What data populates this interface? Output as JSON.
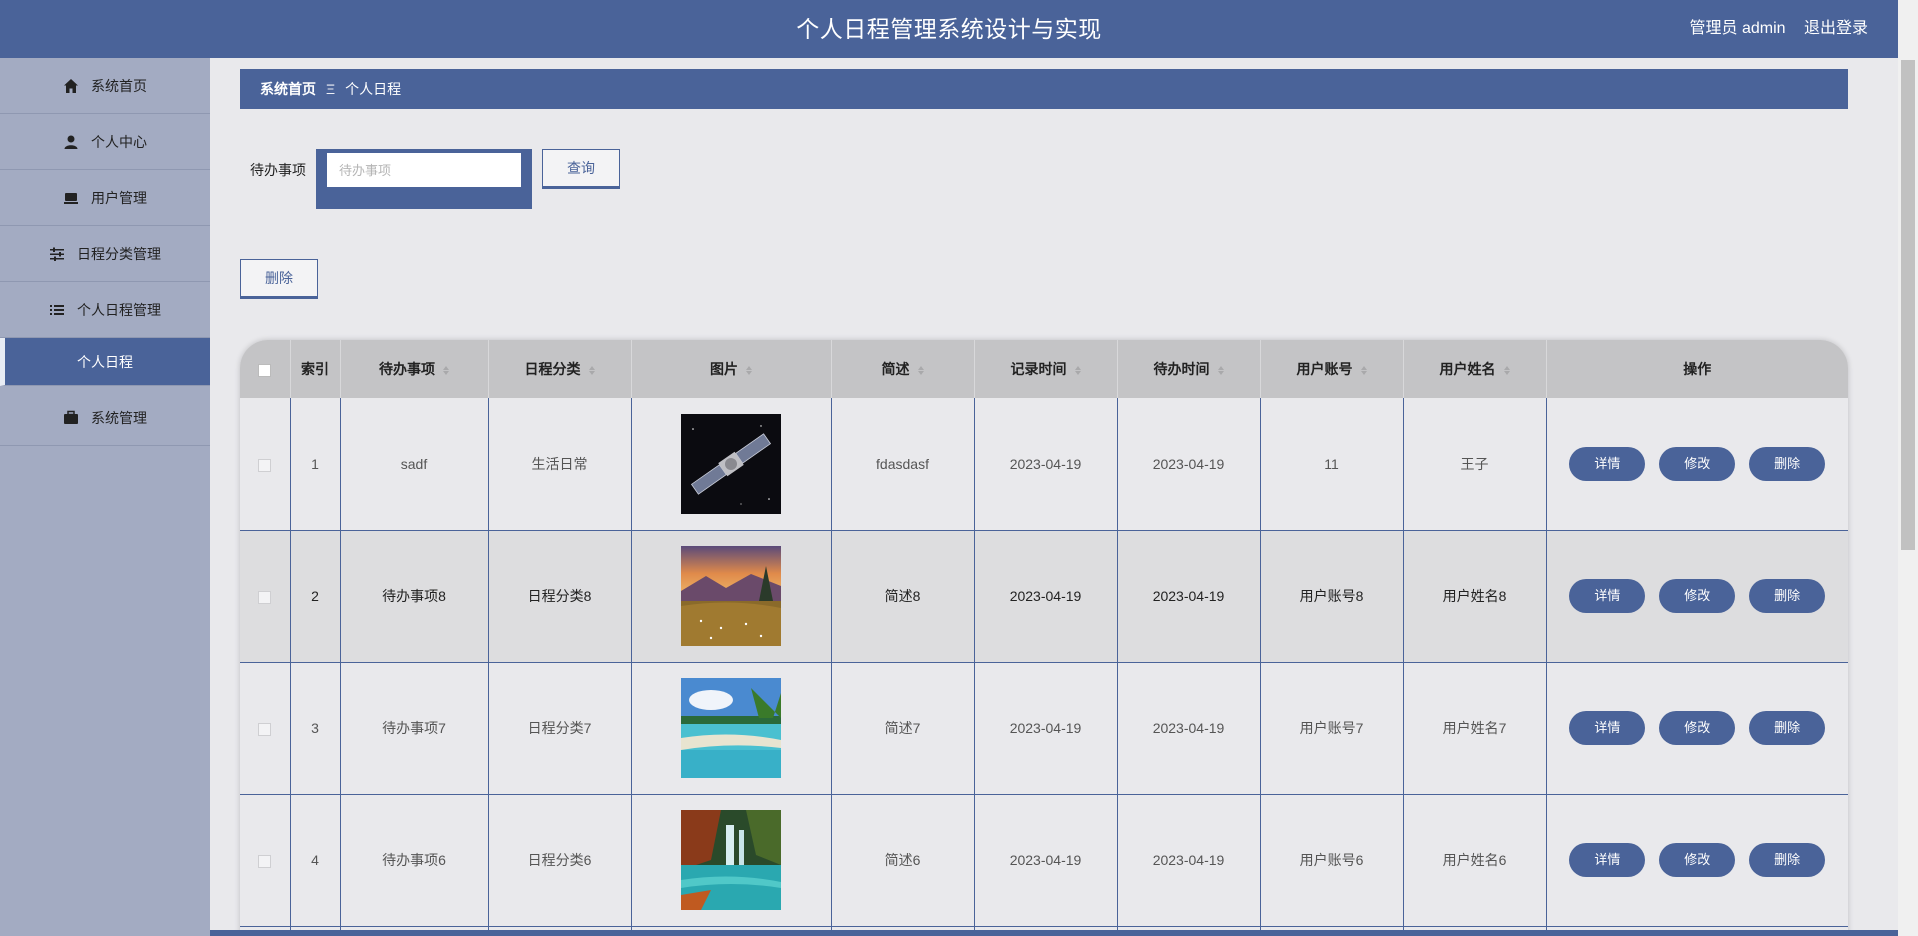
{
  "header": {
    "title": "个人日程管理系统设计与实现",
    "role": "管理员 admin",
    "logout": "退出登录"
  },
  "sidebar": {
    "items": [
      {
        "label": "系统首页",
        "icon": "home-icon"
      },
      {
        "label": "个人中心",
        "icon": "user-icon"
      },
      {
        "label": "用户管理",
        "icon": "users-icon"
      },
      {
        "label": "日程分类管理",
        "icon": "sliders-icon"
      },
      {
        "label": "个人日程管理",
        "icon": "list-icon"
      },
      {
        "label": "个人日程",
        "active": true
      },
      {
        "label": "系统管理",
        "icon": "briefcase-icon"
      }
    ]
  },
  "breadcrumb": {
    "home": "系统首页",
    "separator": "Ξ",
    "current": "个人日程"
  },
  "search": {
    "label": "待办事项",
    "placeholder": "待办事项",
    "query_button": "查询"
  },
  "toolbar": {
    "delete_button": "删除"
  },
  "table": {
    "columns": [
      "索引",
      "待办事项",
      "日程分类",
      "图片",
      "简述",
      "记录时间",
      "待办时间",
      "用户账号",
      "用户姓名",
      "操作"
    ],
    "rows": [
      {
        "index": "1",
        "todo": "sadf",
        "category": "生活日常",
        "image": "satellite-image",
        "summary": "fdasdasf",
        "record_time": "2023-04-19",
        "due_time": "2023-04-19",
        "account": "11",
        "name": "王子"
      },
      {
        "index": "2",
        "todo": "待办事项8",
        "category": "日程分类8",
        "image": "sunset-meadow-image",
        "summary": "简述8",
        "record_time": "2023-04-19",
        "due_time": "2023-04-19",
        "account": "用户账号8",
        "name": "用户姓名8"
      },
      {
        "index": "3",
        "todo": "待办事项7",
        "category": "日程分类7",
        "image": "beach-image",
        "summary": "简述7",
        "record_time": "2023-04-19",
        "due_time": "2023-04-19",
        "account": "用户账号7",
        "name": "用户姓名7"
      },
      {
        "index": "4",
        "todo": "待办事项6",
        "category": "日程分类6",
        "image": "waterfall-image",
        "summary": "简述6",
        "record_time": "2023-04-19",
        "due_time": "2023-04-19",
        "account": "用户账号6",
        "name": "用户姓名6"
      }
    ],
    "actions": {
      "detail": "详情",
      "edit": "修改",
      "delete": "删除"
    }
  },
  "colors": {
    "primary": "#4a6399",
    "sidebar_bg": "#a3abc2",
    "page_bg": "#e9e9ec",
    "header_row_bg": "#c4c4c6"
  }
}
